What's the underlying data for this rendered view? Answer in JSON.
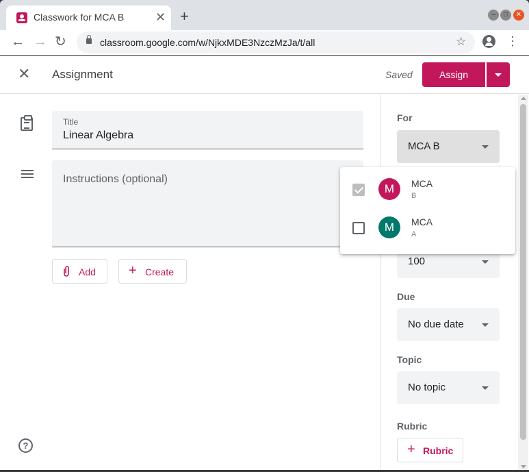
{
  "browser": {
    "tab_title": "Classwork for MCA B",
    "tab_close": "✕",
    "new_tab": "+",
    "url": "classroom.google.com/w/NjkxMDE3NzczMzJa/t/all",
    "win_min": "–",
    "win_max": "□",
    "win_close": "✕",
    "back": "←",
    "forward": "→",
    "reload": "↻",
    "star": "☆",
    "menu": "⋮"
  },
  "header": {
    "close": "✕",
    "title": "Assignment",
    "saved": "Saved",
    "assign_label": "Assign"
  },
  "form": {
    "title_label": "Title",
    "title_value": "Linear Algebra",
    "instructions_placeholder": "Instructions (optional)",
    "add_icon": "⊘",
    "add_label": "Add",
    "create_icon": "+",
    "create_label": "Create",
    "help": "?"
  },
  "sidebar": {
    "for_label": "For",
    "for_value": "MCA B",
    "points_value": "100",
    "due_label": "Due",
    "due_value": "No due date",
    "topic_label": "Topic",
    "topic_value": "No topic",
    "rubric_label": "Rubric",
    "rubric_icon": "+",
    "rubric_button": "Rubric"
  },
  "class_dropdown": {
    "options": [
      {
        "name": "MCA",
        "sub": "B",
        "initial": "M",
        "checked": true,
        "color": "#c2185b"
      },
      {
        "name": "MCA",
        "sub": "A",
        "initial": "M",
        "checked": false,
        "color": "#00796b"
      }
    ]
  },
  "colors": {
    "accent": "#c2185b",
    "avatar_a": "#00796b"
  }
}
